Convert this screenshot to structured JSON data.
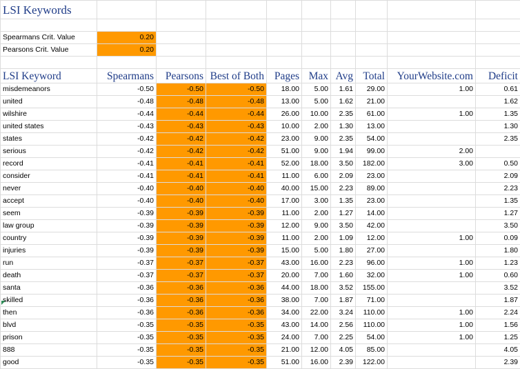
{
  "title": "LSI Keywords",
  "params": [
    {
      "label": "Spearmans Crit. Value",
      "value": "0.20"
    },
    {
      "label": "Pearsons Crit. Value",
      "value": "0.20"
    }
  ],
  "headers": [
    "LSI Keyword",
    "Spearmans",
    "Pearsons",
    "Best of Both",
    "Pages",
    "Max",
    "Avg",
    "Total",
    "YourWebsite.com",
    "Deficit"
  ],
  "rows": [
    [
      "misdemeanors",
      "-0.50",
      "-0.50",
      "-0.50",
      "18.00",
      "5.00",
      "1.61",
      "29.00",
      "1.00",
      "0.61"
    ],
    [
      "united",
      "-0.48",
      "-0.48",
      "-0.48",
      "13.00",
      "5.00",
      "1.62",
      "21.00",
      "",
      "1.62"
    ],
    [
      "wilshire",
      "-0.44",
      "-0.44",
      "-0.44",
      "26.00",
      "10.00",
      "2.35",
      "61.00",
      "1.00",
      "1.35"
    ],
    [
      "united states",
      "-0.43",
      "-0.43",
      "-0.43",
      "10.00",
      "2.00",
      "1.30",
      "13.00",
      "",
      "1.30"
    ],
    [
      "states",
      "-0.42",
      "-0.42",
      "-0.42",
      "23.00",
      "9.00",
      "2.35",
      "54.00",
      "",
      "2.35"
    ],
    [
      "serious",
      "-0.42",
      "-0.42",
      "-0.42",
      "51.00",
      "9.00",
      "1.94",
      "99.00",
      "2.00",
      ""
    ],
    [
      "record",
      "-0.41",
      "-0.41",
      "-0.41",
      "52.00",
      "18.00",
      "3.50",
      "182.00",
      "3.00",
      "0.50"
    ],
    [
      "consider",
      "-0.41",
      "-0.41",
      "-0.41",
      "11.00",
      "6.00",
      "2.09",
      "23.00",
      "",
      "2.09"
    ],
    [
      "never",
      "-0.40",
      "-0.40",
      "-0.40",
      "40.00",
      "15.00",
      "2.23",
      "89.00",
      "",
      "2.23"
    ],
    [
      "accept",
      "-0.40",
      "-0.40",
      "-0.40",
      "17.00",
      "3.00",
      "1.35",
      "23.00",
      "",
      "1.35"
    ],
    [
      "seem",
      "-0.39",
      "-0.39",
      "-0.39",
      "11.00",
      "2.00",
      "1.27",
      "14.00",
      "",
      "1.27"
    ],
    [
      "law group",
      "-0.39",
      "-0.39",
      "-0.39",
      "12.00",
      "9.00",
      "3.50",
      "42.00",
      "",
      "3.50"
    ],
    [
      "country",
      "-0.39",
      "-0.39",
      "-0.39",
      "11.00",
      "2.00",
      "1.09",
      "12.00",
      "1.00",
      "0.09"
    ],
    [
      "injuries",
      "-0.39",
      "-0.39",
      "-0.39",
      "15.00",
      "5.00",
      "1.80",
      "27.00",
      "",
      "1.80"
    ],
    [
      "run",
      "-0.37",
      "-0.37",
      "-0.37",
      "43.00",
      "16.00",
      "2.23",
      "96.00",
      "1.00",
      "1.23"
    ],
    [
      "death",
      "-0.37",
      "-0.37",
      "-0.37",
      "20.00",
      "7.00",
      "1.60",
      "32.00",
      "1.00",
      "0.60"
    ],
    [
      "santa",
      "-0.36",
      "-0.36",
      "-0.36",
      "44.00",
      "18.00",
      "3.52",
      "155.00",
      "",
      "3.52"
    ],
    [
      "skilled",
      "-0.36",
      "-0.36",
      "-0.36",
      "38.00",
      "7.00",
      "1.87",
      "71.00",
      "",
      "1.87"
    ],
    [
      "then",
      "-0.36",
      "-0.36",
      "-0.36",
      "34.00",
      "22.00",
      "3.24",
      "110.00",
      "1.00",
      "2.24"
    ],
    [
      "blvd",
      "-0.35",
      "-0.35",
      "-0.35",
      "43.00",
      "14.00",
      "2.56",
      "110.00",
      "1.00",
      "1.56"
    ],
    [
      "prison",
      "-0.35",
      "-0.35",
      "-0.35",
      "24.00",
      "7.00",
      "2.25",
      "54.00",
      "1.00",
      "1.25"
    ],
    [
      "888",
      "-0.35",
      "-0.35",
      "-0.35",
      "21.00",
      "12.00",
      "4.05",
      "85.00",
      "",
      "4.05"
    ],
    [
      "good",
      "-0.35",
      "-0.35",
      "-0.35",
      "51.00",
      "16.00",
      "2.39",
      "122.00",
      "",
      "2.39"
    ]
  ],
  "colors": {
    "highlight": "#ff9900",
    "header_text": "#1f3c88",
    "gridline": "#dcdcdc"
  }
}
